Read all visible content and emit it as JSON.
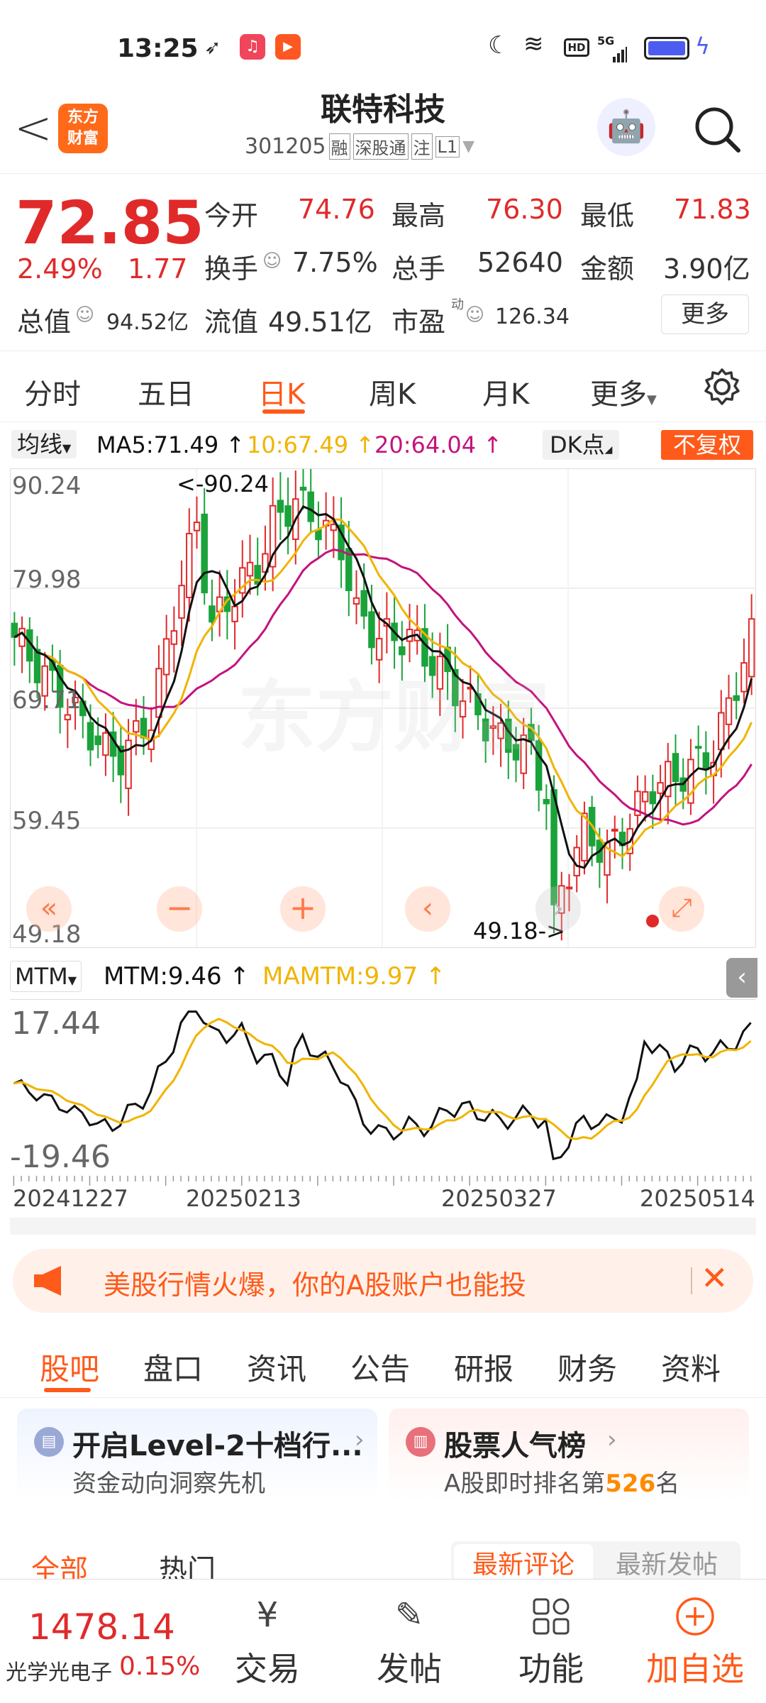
{
  "status_bar": {
    "time": "13:25",
    "network": "5G",
    "hd": "HD"
  },
  "header": {
    "back_label": "<",
    "logo_line1": "东方",
    "logo_line2": "财富",
    "stock_name": "联特科技",
    "stock_code": "301205",
    "tags": [
      "融",
      "深股通",
      "注",
      "L1"
    ]
  },
  "quote": {
    "price": "72.85",
    "change_pct": "2.49%",
    "change": "1.77",
    "open_label": "今开",
    "open": "74.76",
    "high_label": "最高",
    "high": "76.30",
    "low_label": "最低",
    "low": "71.83",
    "turnover_label": "换手",
    "turnover": "7.75%",
    "volume_label": "总手",
    "volume": "52640",
    "amount_label": "金额",
    "amount": "3.90亿",
    "mktcap_label": "总值",
    "mktcap": "94.52亿",
    "float_label": "流值",
    "float_cap": "49.51亿",
    "pe_label": "市盈",
    "pe_sup": "动",
    "pe": "126.34",
    "more_label": "更多"
  },
  "period_tabs": [
    "分时",
    "五日",
    "日K",
    "周K",
    "月K",
    "更多"
  ],
  "active_period": "日K",
  "chart": {
    "ma_selector": "均线",
    "ma5": "MA5:71.49",
    "ma10": "10:67.49",
    "ma20": "20:64.04",
    "dk_label": "DK点",
    "fq_label": "不复权",
    "y_labels": [
      "90.24",
      "79.98",
      "69.71",
      "59.45",
      "49.18"
    ],
    "high_marker": "<-90.24",
    "low_marker": "49.18->",
    "watermark": "东方财富",
    "mtm_selector": "MTM",
    "mtm_value": "MTM:9.46",
    "mamtm_value": "MAMTM:9.97",
    "mtm_top": "17.44",
    "mtm_bottom": "-19.46",
    "dates": [
      "20241227",
      "20250213",
      "20250327",
      "20250514"
    ],
    "colors": {
      "up": "#e02a2a",
      "down": "#1aa33a",
      "ma5": "#111111",
      "ma10": "#f0b400",
      "ma20": "#c4137d",
      "mtm": "#111111",
      "mamtm": "#f0b400"
    }
  },
  "banner": {
    "text": "美股行情火爆，你的A股账户也能投"
  },
  "sub_tabs": [
    "股吧",
    "盘口",
    "资讯",
    "公告",
    "研报",
    "财务",
    "资料"
  ],
  "active_sub_tab": "股吧",
  "cards": [
    {
      "title": "开启Level-2十档行...",
      "subtitle": "资金动向洞察先机"
    },
    {
      "title": "股票人气榜",
      "subtitle_pre": "A股即时排名第",
      "rank": "526",
      "subtitle_post": "名"
    }
  ],
  "filter_row": {
    "left": [
      "全部",
      "热门"
    ],
    "right": [
      "最新评论",
      "最新发帖"
    ]
  },
  "bottom_bar": {
    "index_value": "1478.14",
    "index_name": "光学光电子",
    "index_change": "0.15%",
    "actions": [
      "交易",
      "发帖",
      "功能",
      "加自选"
    ]
  }
}
